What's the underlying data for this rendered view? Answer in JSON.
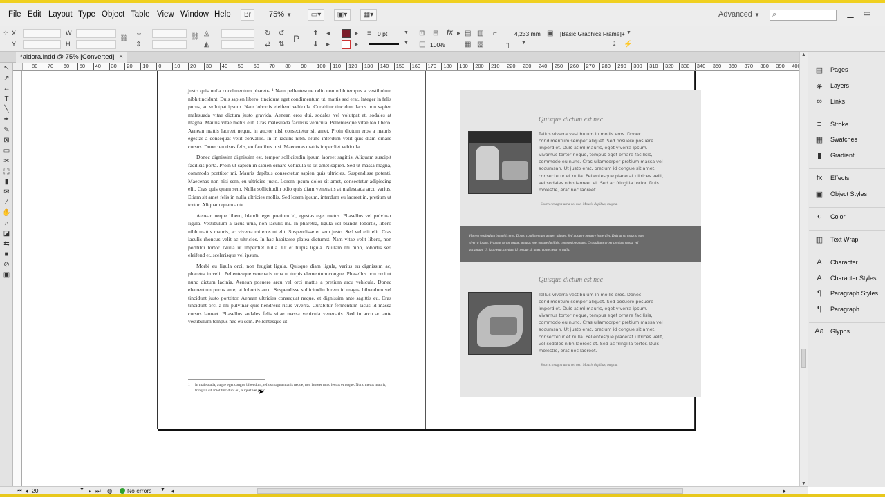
{
  "menubar": {
    "items": [
      "File",
      "Edit",
      "Layout",
      "Type",
      "Object",
      "Table",
      "View",
      "Window",
      "Help"
    ],
    "bridge_button": "Br",
    "zoom": "75%",
    "workspace": "Advanced"
  },
  "control": {
    "x_label": "X:",
    "y_label": "Y:",
    "w_label": "W:",
    "h_label": "H:",
    "stroke_weight": "0 pt",
    "zoom_percent": "100%",
    "dimension": "4,233 mm",
    "object_style": "[Basic Graphics Frame]+"
  },
  "document": {
    "tab_title": "*aldora.indd @ 75% [Converted]",
    "close": "×"
  },
  "ruler": {
    "labels": [
      "80",
      "70",
      "60",
      "50",
      "40",
      "30",
      "20",
      "10",
      "0",
      "10",
      "20",
      "30",
      "40",
      "50",
      "60",
      "70",
      "80",
      "90",
      "100",
      "110",
      "120",
      "130",
      "140",
      "150",
      "160",
      "170",
      "180",
      "190",
      "200",
      "210",
      "220",
      "230",
      "240",
      "250",
      "260",
      "270",
      "280",
      "290",
      "300",
      "310",
      "320",
      "330",
      "340",
      "350",
      "360",
      "370",
      "380",
      "390",
      "400"
    ]
  },
  "left_page": {
    "paragraphs": [
      "justo quis nulla condimentum pharetra.¹ Nam pellentesque odio non nibh tempus a vestibulum nibh tincidunt. Duis sapien libero, tincidunt eget condimentum ut, mattis sed erat. Integer in felis purus, ac volutpat ipsum. Nam lobortis eleifend vehicula. Curabitur tincidunt lacus non sapien malesuada vitae dictum justo gravida. Aenean eros dui, sodales vel volutpat et, sodales at magna. Mauris vitae metus elit. Cras malesuada facilisis vehicula. Pellentesque vitae leo libero. Aenean mattis laoreet neque, in auctor nisl consectetur sit amet. Proin dictum eros a mauris egestas a consequat velit convallis. In in iaculis nibh. Nunc interdum velit quis diam ornare cursus. Donec eu risus felis, eu faucibus nisi. Maecenas mattis imperdiet vehicula.",
      "Donec dignissim dignissim est, tempor sollicitudin ipsum laoreet sagittis. Aliquam suscipit facilisis porta. Proin ut sapien in sapien ornare vehicula ut sit amet sapien. Sed ut massa magna, commodo porttitor mi. Mauris dapibus consectetur sapien quis ultricies. Suspendisse potenti. Maecenas non nisi sem, eu ultricies justo. Lorem ipsum dolor sit amet, consectetur adipiscing elit. Cras quis quam sem. Nulla sollicitudin odio quis diam venenatis at malesuada arcu varius. Etiam sit amet felis in nulla ultricies mollis. Sed lorem ipsum, interdum eu laoreet in, pretium ut tortor. Aliquam quam ante.",
      "Aenean neque libero, blandit eget pretium id, egestas eget metus. Phasellus vel pulvinar ligula. Vestibulum a lacus urna, non iaculis mi. In pharetra, ligula vel blandit lobortis, libero nibh mattis mauris, ac viverra mi eros ut elit. Suspendisse et sem justo. Sed vel elit elit. Cras iaculis rhoncus velit ac ultricies. In hac habitasse platea dictumst. Nam vitae velit libero, non porttitor tortor. Nulla ut imperdiet nulla. Ut et turpis ligula. Nullam mi nibh, lobortis sed eleifend et, scelerisque vel ipsum.",
      "Morbi eu ligula orci, non feugiat ligula. Quisque diam ligula, varius eu dignissim ac, pharetra in velit. Pellentesque venenatis urna ut turpis elementum congue. Phasellus non orci ut nunc dictum lacinia. Aenean posuere arcu vel orci mattis a pretium arcu vehicula. Donec elementum purus ante, at lobortis arcu. Suspendisse sollicitudin lorem id magna bibendum vel tincidunt justo porttitor. Aenean ultricies consequat neque, et dignissim ante sagittis eu. Cras tincidunt orci a mi pulvinar quis hendrerit risus viverra. Curabitur fermentum lacus id massa cursus laoreet. Phasellus sodales felis vitae massa vehicula venenatis. Sed in arcu ac ante vestibulum tempus nec eu sem. Pellentesque ut"
    ],
    "footnote_number": "1",
    "footnote": "In malesuada, augue eget congue bibendum, tellus magna mattis neque, non laoreet nunc lectus et neque. Nunc metus mauris, fringilla sit amet tincidunt eu, aliquet vel justo."
  },
  "right_page": {
    "article1": {
      "title": "Quisque dictum est nec",
      "body": "Tellus viverra vestibulum in mollis eros. Donec condimentum semper aliquet. Sed posuere posuere imperdiet. Duis at mi mauris, eget viverra ipsum. Vivamus tortor neque, tempus eget ornare facilisis, commodo eu nunc. Cras ullamcorper pretium massa vel accumsan. Ut justo erat, pretium id congue sit amet, consectetur et nulla. Pellentesque placerat ultrices velit, vel sodales nibh laoreet et. Sed ac fringilla tortor. Duis molestie, erat nec laoreet.",
      "source": "Source: magna urna vel nec. Mauris dapibus, magna."
    },
    "band": "Viverra vestibulum in mollis eros. Donec condimentum semper aliquet. Sed posuere posuere imperdiet. Duis at mi mauris, eget viverra ipsum. Vivamus tortor neque, tempus eget ornare facilisis, commodo eu nunc. Cras ullamcorper pretium massa vel accumsan. Ut justo erat, pretium id congue sit amet, consectetur et nulla.",
    "article2": {
      "title": "Quisque dictum est nec",
      "body": "Tellus viverra vestibulum in mollis eros. Donec condimentum semper aliquet. Sed posuere posuere imperdiet. Duis at mi mauris, eget viverra ipsum. Vivamus tortor neque, tempus eget ornare facilisis, commodo eu nunc. Cras ullamcorper pretium massa vel accumsan. Ut justo erat, pretium id congue sit amet, consectetur et nulla. Pellentesque placerat ultrices velit, vel sodales nibh laoreet et. Sed ac fringilla tortor. Duis molestie, erat nec laoreet.",
      "source": "Source: magna urna vel nec. Mauris dapibus, magna."
    }
  },
  "statusbar": {
    "page": "20",
    "errors": "No errors"
  },
  "panels": [
    {
      "label": "Pages",
      "icon": "pages-icon",
      "glyph": "▤"
    },
    {
      "label": "Layers",
      "icon": "layers-icon",
      "glyph": "◈"
    },
    {
      "label": "Links",
      "icon": "links-icon",
      "glyph": "∞"
    },
    {
      "label": "Stroke",
      "icon": "stroke-icon",
      "glyph": "≡"
    },
    {
      "label": "Swatches",
      "icon": "swatches-icon",
      "glyph": "▦"
    },
    {
      "label": "Gradient",
      "icon": "gradient-icon",
      "glyph": "▮"
    },
    {
      "label": "Effects",
      "icon": "effects-icon",
      "glyph": "fx"
    },
    {
      "label": "Object Styles",
      "icon": "object-styles-icon",
      "glyph": "▣"
    },
    {
      "label": "Color",
      "icon": "color-icon",
      "glyph": "◐"
    },
    {
      "label": "Text Wrap",
      "icon": "text-wrap-icon",
      "glyph": "▥"
    },
    {
      "label": "Character",
      "icon": "character-icon",
      "glyph": "A"
    },
    {
      "label": "Character Styles",
      "icon": "character-styles-icon",
      "glyph": "A"
    },
    {
      "label": "Paragraph Styles",
      "icon": "paragraph-styles-icon",
      "glyph": "¶"
    },
    {
      "label": "Paragraph",
      "icon": "paragraph-icon",
      "glyph": "¶"
    },
    {
      "label": "Glyphs",
      "icon": "glyphs-icon",
      "glyph": "Aa"
    }
  ],
  "colors": {
    "fill_swatch": "#7b1d2a",
    "status_ok": "#2fa02f"
  }
}
